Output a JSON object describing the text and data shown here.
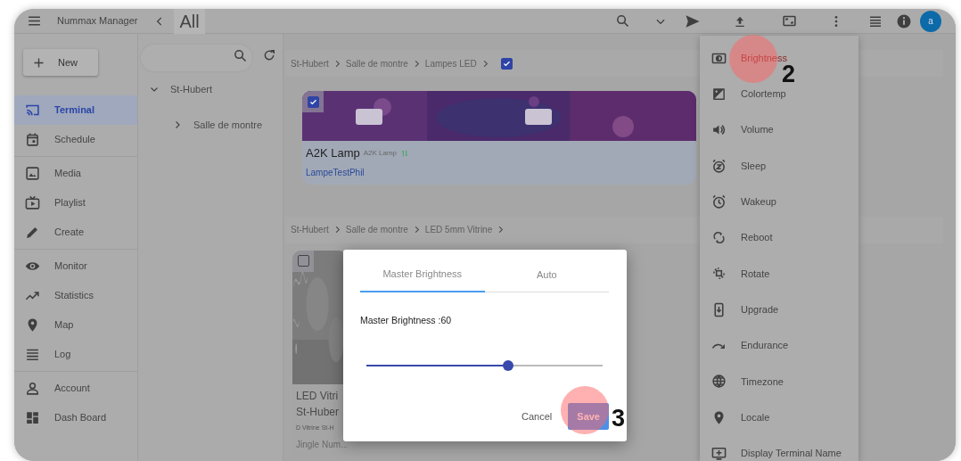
{
  "header": {
    "title": "Nummax Manager",
    "filter": "All",
    "avatar": "a"
  },
  "sidebar": {
    "new_button": "New",
    "groups": [
      {
        "items": [
          {
            "label": "Terminal",
            "selected": true
          },
          {
            "label": "Schedule",
            "selected": false
          }
        ]
      },
      {
        "items": [
          {
            "label": "Media",
            "selected": false
          },
          {
            "label": "Playlist",
            "selected": false
          },
          {
            "label": "Create",
            "selected": false
          }
        ]
      },
      {
        "items": [
          {
            "label": "Monitor",
            "selected": false
          },
          {
            "label": "Statistics",
            "selected": false
          },
          {
            "label": "Map",
            "selected": false
          },
          {
            "label": "Log",
            "selected": false
          }
        ]
      },
      {
        "items": [
          {
            "label": "Account",
            "selected": false
          },
          {
            "label": "Dash Board",
            "selected": false
          }
        ]
      }
    ]
  },
  "tree": {
    "nodes": [
      {
        "label": "St-Hubert",
        "expanded": true,
        "children": [
          {
            "label": "Salle de montre",
            "expanded": false
          }
        ]
      }
    ]
  },
  "groups": [
    {
      "breadcrumb": [
        "St-Hubert",
        "Salle de montre",
        "Lampes LED"
      ],
      "checked": true,
      "cards": [
        {
          "name": "A2K Lamp",
          "model": "A2K Lamp",
          "terminal": "LampeTestPhil",
          "checked": true,
          "selected": true
        }
      ]
    },
    {
      "breadcrumb": [
        "St-Hubert",
        "Salle de montre",
        "LED 5mm Vitrine"
      ],
      "cards": [
        {
          "name": "LED Vitri",
          "location": "St-Huber",
          "model": "D Vitrine St-H",
          "terminal": "Jingle Num…",
          "checked": false,
          "selected": false
        }
      ]
    }
  ],
  "menu": {
    "items": [
      "Brightness",
      "Colortemp",
      "Volume",
      "Sleep",
      "Wakeup",
      "Reboot",
      "Rotate",
      "Upgrade",
      "Endurance",
      "Timezone",
      "Locale",
      "Display Terminal Name"
    ]
  },
  "dialog": {
    "tabs": [
      {
        "label": "Master Brightness",
        "selected": true
      },
      {
        "label": "Auto",
        "selected": false
      }
    ],
    "label": "Master Brightness :60",
    "slider": {
      "level": 0.6
    },
    "buttons": [
      {
        "label": "Cancel",
        "kind": "text"
      },
      {
        "label": "Save",
        "kind": "primary"
      }
    ]
  },
  "markers": [
    {
      "label": "2"
    },
    {
      "label": "3"
    }
  ]
}
